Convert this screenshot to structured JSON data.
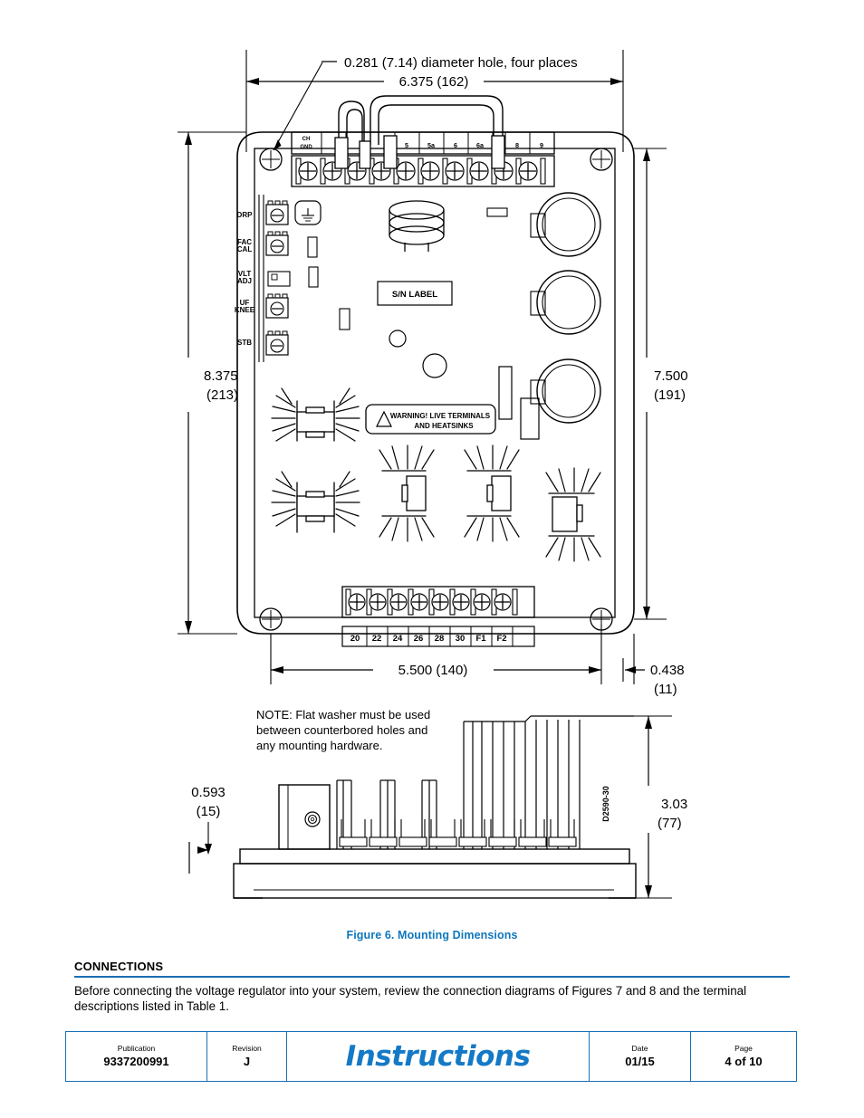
{
  "document": {
    "figure_caption_prefix": "Figure 6",
    "figure_caption": ". Mounting Dimensions",
    "accent_color": "#0f76bc"
  },
  "figure": {
    "callout_hole": "0.281 (7.14) diameter hole, four places",
    "dim_width_top": "6.375 (162)",
    "dim_height_left_in": "8.375",
    "dim_height_left_mm": "(213)",
    "dim_height_right_in": "7.500",
    "dim_height_right_mm": "(191)",
    "dim_width_bottom": "5.500 (140)",
    "dim_edge_in": "0.438",
    "dim_edge_mm": "(11)",
    "dim_depth_left_in": "0.593",
    "dim_depth_left_mm": "(15)",
    "dim_depth_right_in": "3.03",
    "dim_depth_right_mm": "(77)",
    "note_line1": "NOTE: Flat washer must be used",
    "note_line2": "between counterbored holes and",
    "note_line3": "any mounting hardware.",
    "drawing_number": "D2590-30",
    "sn_label": "S/N LABEL",
    "warning_line1": "WARNING! LIVE TERMINALS",
    "warning_line2": "AND HEATSINKS",
    "top_terminals": [
      "CH GND",
      "",
      "",
      "",
      "5",
      "5a",
      "6",
      "6a",
      "",
      "8",
      "9",
      ""
    ],
    "top_terminal_first_line1": "CH",
    "top_terminal_first_line2": "GND",
    "bottom_terminals": [
      "20",
      "22",
      "24",
      "26",
      "28",
      "30",
      "F1",
      "F2",
      ""
    ],
    "pot_labels": [
      {
        "line1": "DRP",
        "line2": ""
      },
      {
        "line1": "FAC",
        "line2": "CAL"
      },
      {
        "line1": "VLT",
        "line2": "ADJ"
      },
      {
        "line1": "UF",
        "line2": "KNEE"
      },
      {
        "line1": "STB",
        "line2": ""
      }
    ]
  },
  "connections": {
    "heading": "CONNECTIONS",
    "paragraph": "Before connecting the voltage regulator into your system, review the connection diagrams of Figures 7 and 8 and the terminal descriptions listed in Table 1."
  },
  "footer": {
    "publication_label": "Publication",
    "publication_value": "9337200991",
    "revision_label": "Revision",
    "revision_value": "J",
    "title": "Instructions",
    "date_label": "Date",
    "date_value": "01/15",
    "page_label": "Page",
    "page_value": "4 of 10"
  }
}
